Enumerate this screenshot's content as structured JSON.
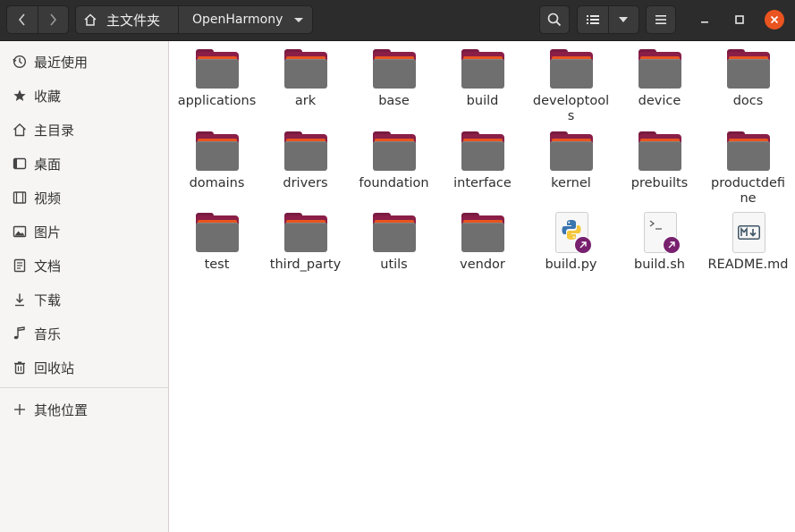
{
  "window": {
    "path_home_label": "主文件夹",
    "path_current_label": "OpenHarmony"
  },
  "colors": {
    "accent": "#e95420",
    "folder_front": "#6f6f6f",
    "folder_back": "#8a1e47",
    "link_badge": "#77216f",
    "headerbar": "#2c2c2c"
  },
  "sidebar": {
    "items": [
      {
        "label": "最近使用",
        "icon": "clock-icon"
      },
      {
        "label": "收藏",
        "icon": "star-icon"
      },
      {
        "label": "主目录",
        "icon": "home-icon"
      },
      {
        "label": "桌面",
        "icon": "desktop-icon"
      },
      {
        "label": "视频",
        "icon": "video-icon"
      },
      {
        "label": "图片",
        "icon": "picture-icon"
      },
      {
        "label": "文档",
        "icon": "document-icon"
      },
      {
        "label": "下载",
        "icon": "download-icon"
      },
      {
        "label": "音乐",
        "icon": "music-icon"
      },
      {
        "label": "回收站",
        "icon": "trash-icon"
      }
    ],
    "other_locations": {
      "label": "其他位置",
      "icon": "plus-icon"
    }
  },
  "files": [
    {
      "name": "applications",
      "kind": "folder"
    },
    {
      "name": "ark",
      "kind": "folder"
    },
    {
      "name": "base",
      "kind": "folder"
    },
    {
      "name": "build",
      "kind": "folder"
    },
    {
      "name": "developtools",
      "kind": "folder"
    },
    {
      "name": "device",
      "kind": "folder"
    },
    {
      "name": "docs",
      "kind": "folder"
    },
    {
      "name": "domains",
      "kind": "folder"
    },
    {
      "name": "drivers",
      "kind": "folder"
    },
    {
      "name": "foundation",
      "kind": "folder"
    },
    {
      "name": "interface",
      "kind": "folder"
    },
    {
      "name": "kernel",
      "kind": "folder"
    },
    {
      "name": "prebuilts",
      "kind": "folder"
    },
    {
      "name": "productdefine",
      "kind": "folder"
    },
    {
      "name": "test",
      "kind": "folder"
    },
    {
      "name": "third_party",
      "kind": "folder"
    },
    {
      "name": "utils",
      "kind": "folder"
    },
    {
      "name": "vendor",
      "kind": "folder"
    },
    {
      "name": "build.py",
      "kind": "python-link"
    },
    {
      "name": "build.sh",
      "kind": "shell-link"
    },
    {
      "name": "README.md",
      "kind": "markdown"
    }
  ]
}
